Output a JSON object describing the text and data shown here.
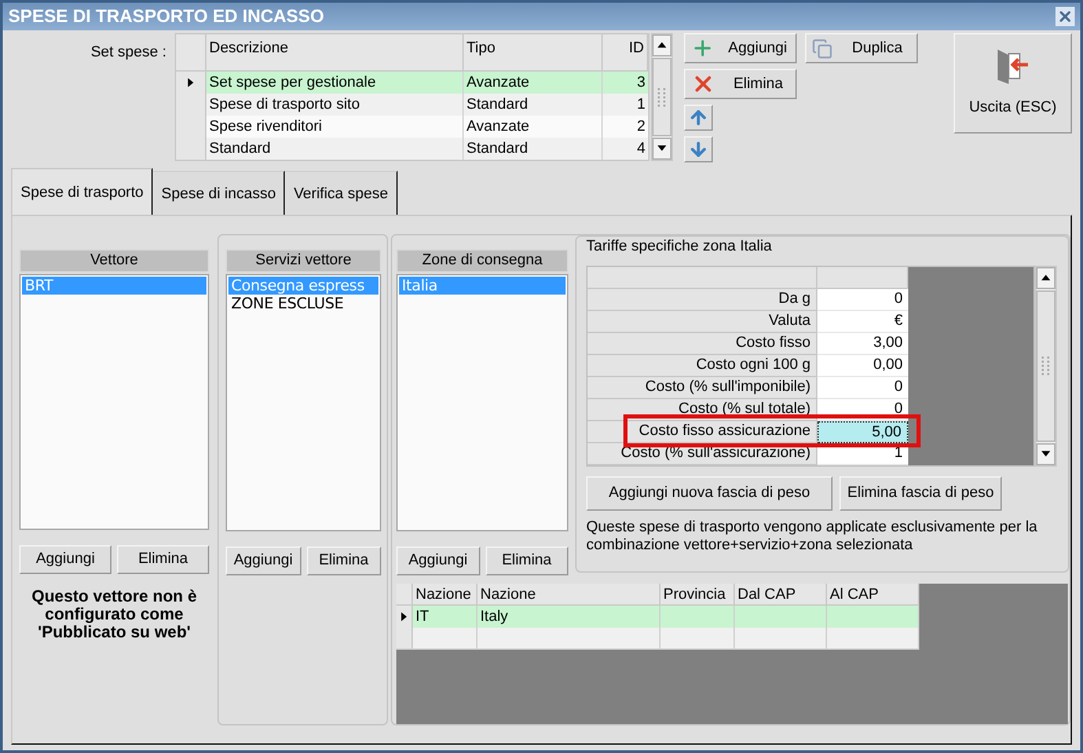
{
  "window": {
    "title": "SPESE DI TRASPORTO ED INCASSO"
  },
  "set_spese": {
    "label": "Set spese :",
    "columns": [
      "Descrizione",
      "Tipo",
      "ID"
    ],
    "rows": [
      {
        "descrizione": "Set spese per gestionale",
        "tipo": "Avanzate",
        "id": "3",
        "selected": true
      },
      {
        "descrizione": "Spese di trasporto sito",
        "tipo": "Standard",
        "id": "1",
        "selected": false
      },
      {
        "descrizione": "Spese rivenditori",
        "tipo": "Avanzate",
        "id": "2",
        "selected": false
      },
      {
        "descrizione": "Standard",
        "tipo": "Standard",
        "id": "4",
        "selected": false
      }
    ]
  },
  "set_buttons": [
    {
      "label": "Aggiungi",
      "kind": "add"
    },
    {
      "label": "Duplica",
      "kind": "duplicate"
    },
    {
      "label": "Elimina",
      "kind": "delete"
    }
  ],
  "exit_button": {
    "label": "Uscita (ESC)"
  },
  "tabs": [
    {
      "label": "Spese di trasporto",
      "selected": true
    },
    {
      "label": "Spese di incasso",
      "selected": false
    },
    {
      "label": "Verifica spese",
      "selected": false
    }
  ],
  "vettore": {
    "header": "Vettore",
    "items": [
      {
        "label": "BRT",
        "selected": true
      }
    ],
    "buttons": [
      "Aggiungi",
      "Elimina"
    ],
    "note": "Questo vettore non è configurato come 'Pubblicato su web'"
  },
  "servizi": {
    "header": "Servizi vettore",
    "items": [
      {
        "label": "Consegna espress",
        "selected": true
      },
      {
        "label": "ZONE ESCLUSE",
        "selected": false
      }
    ],
    "buttons": [
      "Aggiungi",
      "Elimina"
    ]
  },
  "zone": {
    "header": "Zone di consegna",
    "items": [
      {
        "label": "Italia",
        "selected": true
      }
    ],
    "buttons": [
      "Aggiungi",
      "Elimina"
    ]
  },
  "tariffe": {
    "title": "Tariffe specifiche zona Italia",
    "rows": [
      {
        "label": "Da g",
        "value": "0",
        "selected": false
      },
      {
        "label": "Valuta",
        "value": "€",
        "selected": false
      },
      {
        "label": "Costo fisso",
        "value": "3,00",
        "selected": false
      },
      {
        "label": "Costo ogni 100 g",
        "value": "0,00",
        "selected": false
      },
      {
        "label": "Costo (% sull'imponibile)",
        "value": "0",
        "selected": false
      },
      {
        "label": "Costo (% sul totale)",
        "value": "0",
        "selected": false
      },
      {
        "label": "Costo fisso assicurazione",
        "value": "5,00",
        "selected": true
      },
      {
        "label": "Costo (% sull'assicurazione)",
        "value": "1",
        "selected": false
      }
    ],
    "buttons": [
      "Aggiungi nuova fascia di peso",
      "Elimina fascia di peso"
    ],
    "note": "Queste spese di trasporto vengono applicate esclusivamente per la combinazione vettore+servizio+zona selezionata"
  },
  "zone_table": {
    "columns": [
      "Nazione",
      "Nazione",
      "Provincia",
      "Dal CAP",
      "Al CAP"
    ],
    "rows": [
      {
        "code": "IT",
        "name": "Italy",
        "selected": true
      }
    ]
  }
}
